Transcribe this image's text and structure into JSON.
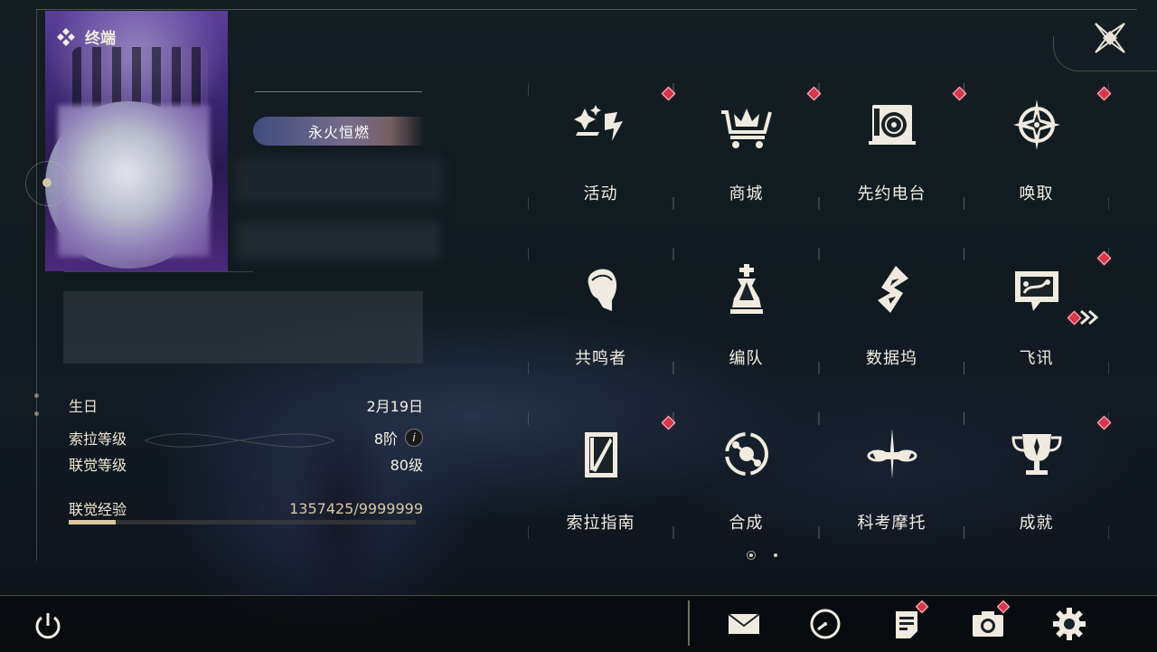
{
  "header": {
    "title": "终端"
  },
  "profile": {
    "title_badge": "永火恒燃",
    "stats": [
      {
        "label": "生日",
        "value": "2月19日"
      },
      {
        "label": "索拉等级",
        "value": "8阶"
      },
      {
        "label": "联觉等级",
        "value": "80级"
      }
    ],
    "exp": {
      "label": "联觉经验",
      "value": "1357425/9999999",
      "fraction": 0.136
    }
  },
  "menu": {
    "items": [
      {
        "label": "活动",
        "icon": "activity-icon",
        "badge": true
      },
      {
        "label": "商城",
        "icon": "shop-cart-icon",
        "badge": true
      },
      {
        "label": "先约电台",
        "icon": "radio-icon",
        "badge": true
      },
      {
        "label": "唤取",
        "icon": "summon-star-icon",
        "badge": true
      },
      {
        "label": "共鸣者",
        "icon": "resonator-icon",
        "badge": false
      },
      {
        "label": "编队",
        "icon": "team-chess-icon",
        "badge": false
      },
      {
        "label": "数据坞",
        "icon": "data-dock-icon",
        "badge": false
      },
      {
        "label": "飞讯",
        "icon": "message-icon",
        "badge": true
      },
      {
        "label": "索拉指南",
        "icon": "guide-icon",
        "badge": true
      },
      {
        "label": "合成",
        "icon": "synthesis-icon",
        "badge": false
      },
      {
        "label": "科考摩托",
        "icon": "motorbike-icon",
        "badge": false
      },
      {
        "label": "成就",
        "icon": "trophy-icon",
        "badge": true
      }
    ],
    "page": {
      "current": 1,
      "total": 2
    }
  },
  "bottom_bar": {
    "left": [
      {
        "icon": "power-icon"
      }
    ],
    "right": [
      {
        "icon": "mail-icon",
        "badge": false
      },
      {
        "icon": "clock-icon",
        "badge": false
      },
      {
        "icon": "notice-icon",
        "badge": true
      },
      {
        "icon": "camera-icon",
        "badge": true
      },
      {
        "icon": "settings-gear-icon",
        "badge": false
      }
    ]
  },
  "colors": {
    "accent_gold": "#d9c79e",
    "badge_red": "#d8344a",
    "text": "#f2eee3"
  }
}
